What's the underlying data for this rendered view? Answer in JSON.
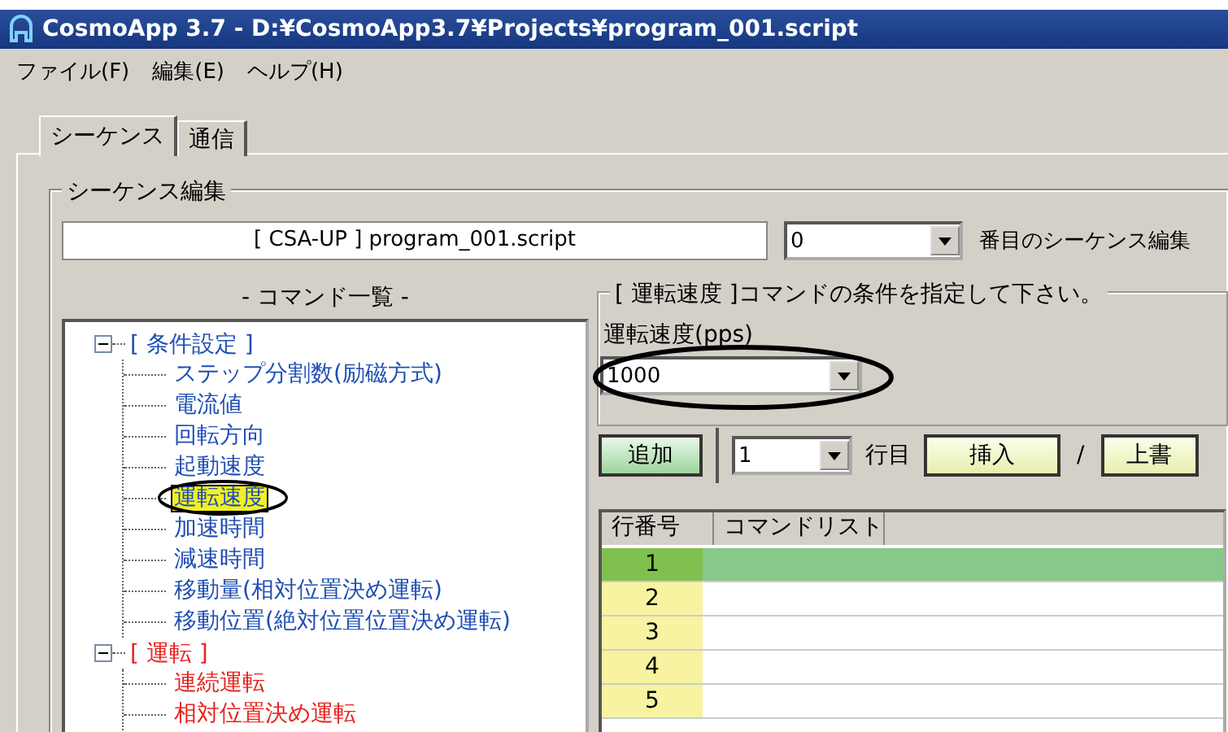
{
  "window": {
    "title": "CosmoApp  3.7 - D:¥CosmoApp3.7¥Projects¥program_001.script"
  },
  "menu": [
    "ファイル(F)",
    "編集(E)",
    "ヘルプ(H)"
  ],
  "tabs": [
    {
      "label": "シーケンス",
      "selected": true
    },
    {
      "label": "通信",
      "selected": false
    }
  ],
  "sequence_edit": {
    "legend": "シーケンス編集",
    "file_field": "[ CSA-UP ] program_001.script",
    "sequence_number": "0",
    "sequence_label": "番目のシーケンス編集"
  },
  "command_list": {
    "heading": "- コマンド一覧 -",
    "groups": [
      {
        "label": "[ 条件設定 ]",
        "color": "#1f4fb4",
        "expanded": true,
        "children": [
          {
            "label": "ステップ分割数(励磁方式)",
            "selected": false
          },
          {
            "label": "電流値",
            "selected": false
          },
          {
            "label": "回転方向",
            "selected": false
          },
          {
            "label": "起動速度",
            "selected": false
          },
          {
            "label": "運転速度",
            "selected": true
          },
          {
            "label": "加速時間",
            "selected": false
          },
          {
            "label": "減速時間",
            "selected": false
          },
          {
            "label": "移動量(相対位置決め運転)",
            "selected": false
          },
          {
            "label": "移動位置(絶対位置位置決め運転)",
            "selected": false
          }
        ]
      },
      {
        "label": "[ 運転 ]",
        "color": "#e8231e",
        "expanded": true,
        "children": [
          {
            "label": "連続運転",
            "selected": false
          },
          {
            "label": "相対位置決め運転",
            "selected": false
          }
        ]
      }
    ]
  },
  "condition": {
    "legend": "[ 運転速度 ]コマンドの条件を指定して下さい。",
    "field_label": "運転速度(pps)",
    "speed": "1000"
  },
  "toolbar": {
    "add_button": "追加",
    "row_number": "1",
    "row_label": "行目",
    "insert_button": "挿入",
    "separator": "/",
    "overwrite_button": "上書"
  },
  "table": {
    "columns": [
      "行番号",
      "コマンドリスト"
    ],
    "rows": [
      {
        "number": "1",
        "selected": true
      },
      {
        "number": "2",
        "selected": false
      },
      {
        "number": "3",
        "selected": false
      },
      {
        "number": "4",
        "selected": false
      },
      {
        "number": "5",
        "selected": false
      }
    ]
  }
}
